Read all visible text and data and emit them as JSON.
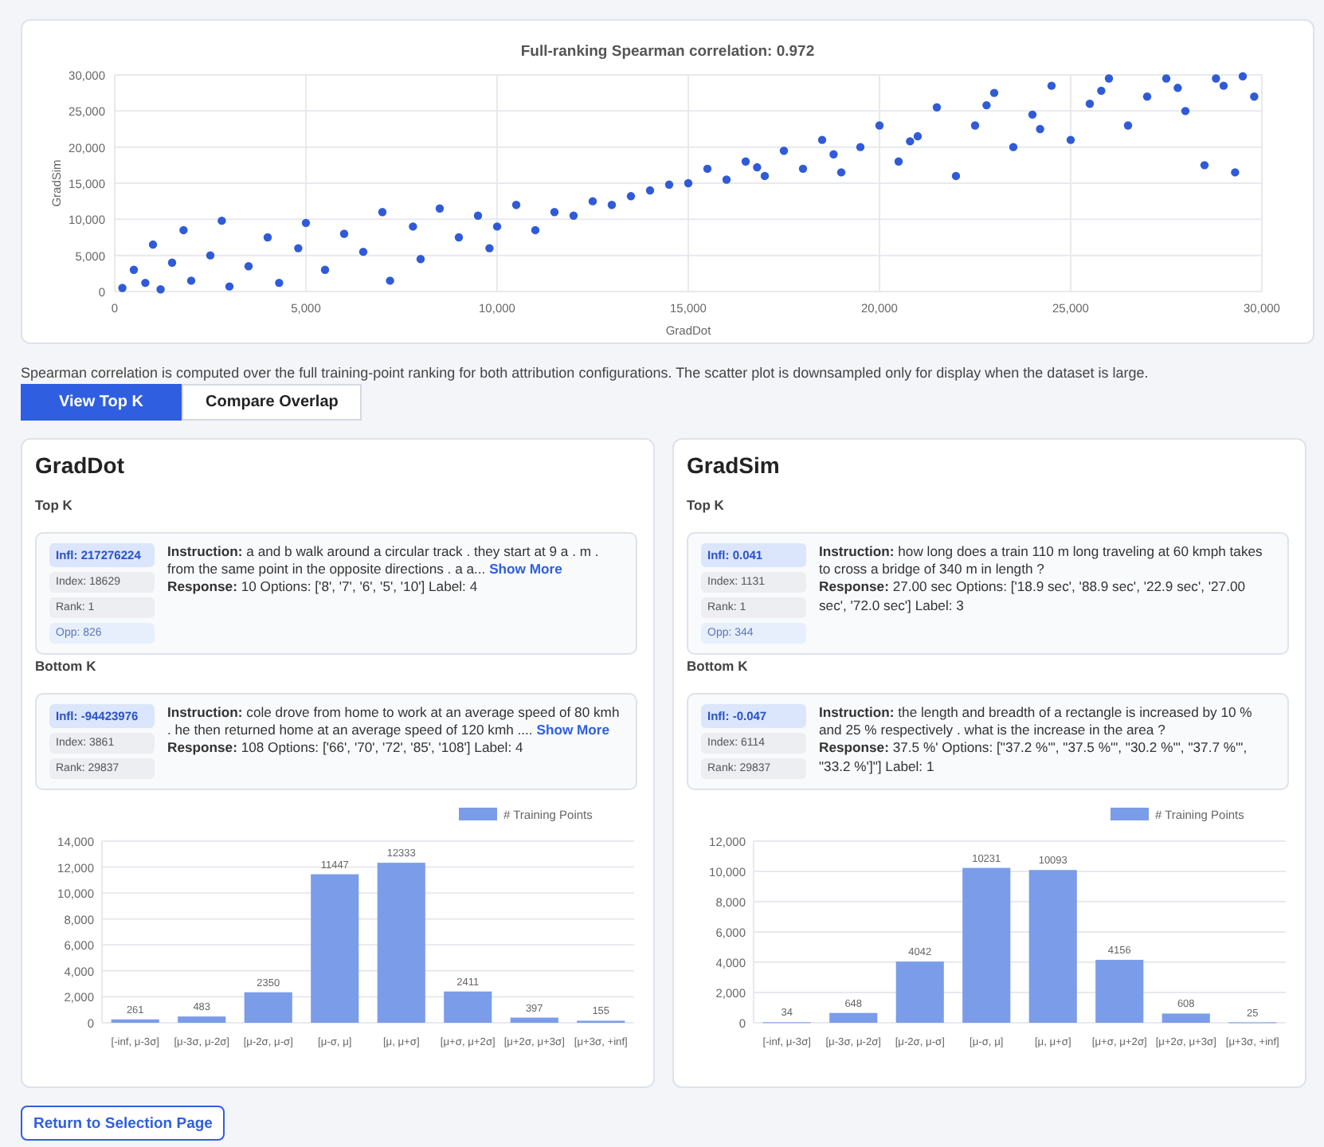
{
  "scatter": {
    "chart_data": {
      "type": "scatter",
      "title": "Full-ranking Spearman correlation: 0.972",
      "xlabel": "GradDot",
      "ylabel": "GradSim",
      "grid": true,
      "xlim": [
        0,
        30000
      ],
      "ylim": [
        0,
        30000
      ],
      "xticks": [
        {
          "value": 0,
          "label": "0"
        },
        {
          "value": 5000,
          "label": "5,000"
        },
        {
          "value": 10000,
          "label": "10,000"
        },
        {
          "value": 15000,
          "label": "15,000"
        },
        {
          "value": 20000,
          "label": "20,000"
        },
        {
          "value": 25000,
          "label": "25,000"
        },
        {
          "value": 30000,
          "label": "30,000"
        }
      ],
      "yticks": [
        {
          "value": 0,
          "label": "0"
        },
        {
          "value": 5000,
          "label": "5,000"
        },
        {
          "value": 10000,
          "label": "10,000"
        },
        {
          "value": 15000,
          "label": "15,000"
        },
        {
          "value": 20000,
          "label": "20,000"
        },
        {
          "value": 25000,
          "label": "25,000"
        },
        {
          "value": 30000,
          "label": "30,000"
        }
      ],
      "x": [
        200,
        500,
        800,
        1000,
        1200,
        1500,
        1800,
        2000,
        2500,
        2800,
        3000,
        3500,
        4000,
        4300,
        4800,
        5000,
        5500,
        6000,
        6500,
        7000,
        7200,
        7800,
        8000,
        8500,
        9000,
        9500,
        9800,
        10000,
        10500,
        11000,
        11500,
        12000,
        12500,
        13000,
        13500,
        14000,
        14500,
        15000,
        15500,
        16000,
        16500,
        16800,
        17000,
        17500,
        18000,
        18500,
        18800,
        19000,
        19500,
        20000,
        20500,
        20800,
        21000,
        21500,
        22000,
        22500,
        22800,
        23000,
        23500,
        24000,
        24200,
        24500,
        25000,
        25500,
        25800,
        26000,
        26500,
        27000,
        27500,
        27800,
        28000,
        28500,
        28800,
        29000,
        29300,
        29500,
        29800
      ],
      "series": [
        {
          "color": "#2f5bd8",
          "values": [
            500,
            3000,
            1200,
            6500,
            300,
            4000,
            8500,
            1500,
            5000,
            9800,
            700,
            3500,
            7500,
            1200,
            6000,
            9500,
            3000,
            8000,
            5500,
            11000,
            1500,
            9000,
            4500,
            11500,
            7500,
            10500,
            6000,
            9000,
            12000,
            8500,
            11000,
            10500,
            12500,
            12000,
            13200,
            14000,
            14800,
            15000,
            17000,
            15500,
            18000,
            17200,
            16000,
            19500,
            17000,
            21000,
            19000,
            16500,
            20000,
            23000,
            18000,
            20800,
            21500,
            25500,
            16000,
            23000,
            25800,
            27500,
            20000,
            24500,
            22500,
            28500,
            21000,
            26000,
            27800,
            29500,
            23000,
            27000,
            29500,
            28200,
            25000,
            17500,
            29500,
            28500,
            16500,
            29800,
            27000
          ]
        }
      ]
    }
  },
  "note": "Spearman correlation is computed over the full training-point ranking for both attribution configurations. The scatter plot is downsampled only for display when the dataset is large.",
  "tabs": [
    {
      "label": "View Top K",
      "selected": true
    },
    {
      "label": "Compare Overlap",
      "selected": false
    }
  ],
  "panels": [
    {
      "title": "GradDot",
      "sections": [
        {
          "heading": "Top K",
          "items": [
            {
              "badges": [
                {
                  "kind": "infl",
                  "text": "Infl: 217276224"
                },
                {
                  "kind": "plain",
                  "text": "Index: 18629"
                },
                {
                  "kind": "plain",
                  "text": "Rank: 1"
                },
                {
                  "kind": "opp",
                  "text": "Opp: 826"
                }
              ],
              "instruction": "**Instruction:** a and b walk around a circular track . they start at 9 a . m . from the same point in the opposite directions . a a...",
              "show_more": "Show More",
              "response": "**Response:** 10 Options: ['8', '7', '6', '5', '10'] Label: 4"
            }
          ]
        },
        {
          "heading": "Bottom K",
          "items": [
            {
              "badges": [
                {
                  "kind": "infl",
                  "text": "Infl: -94423976"
                },
                {
                  "kind": "plain",
                  "text": "Index: 3861"
                },
                {
                  "kind": "plain",
                  "text": "Rank: 29837"
                }
              ],
              "instruction": "**Instruction:** cole drove from home to work at an average speed of 80 kmh . he then returned home at an average speed of 120 kmh ....",
              "show_more": "Show More",
              "response": "**Response:** 108 Options: ['66', '70', '72', '85', '108'] Label: 4"
            }
          ]
        }
      ],
      "chart_data": {
        "type": "bar",
        "grid": true,
        "categories": [
          "[-inf, μ-3σ]",
          "[μ-3σ, μ-2σ]",
          "[μ-2σ, μ-σ]",
          "[μ-σ, μ]",
          "[μ, μ+σ]",
          "[μ+σ, μ+2σ]",
          "[μ+2σ, μ+3σ]",
          "[μ+3σ, +inf]"
        ],
        "ylim": [
          0,
          14000
        ],
        "yticks": [
          {
            "value": 0,
            "label": "0"
          },
          {
            "value": 2000,
            "label": "2,000"
          },
          {
            "value": 4000,
            "label": "4,000"
          },
          {
            "value": 6000,
            "label": "6,000"
          },
          {
            "value": 8000,
            "label": "8,000"
          },
          {
            "value": 10000,
            "label": "10,000"
          },
          {
            "value": 12000,
            "label": "12,000"
          },
          {
            "value": 14000,
            "label": "14,000"
          }
        ],
        "data_labels": true,
        "series": [
          {
            "name": "# Training Points",
            "color": "#7b9ce9",
            "values": [
              261,
              483,
              2350,
              11447,
              12333,
              2411,
              397,
              155
            ]
          }
        ]
      }
    },
    {
      "title": "GradSim",
      "sections": [
        {
          "heading": "Top K",
          "items": [
            {
              "badges": [
                {
                  "kind": "infl",
                  "text": "Infl: 0.041"
                },
                {
                  "kind": "plain",
                  "text": "Index: 1131"
                },
                {
                  "kind": "plain",
                  "text": "Rank: 1"
                },
                {
                  "kind": "opp",
                  "text": "Opp: 344"
                }
              ],
              "instruction": "**Instruction:** how long does a train 110 m long traveling at 60 kmph takes to cross a bridge of 340 m in length ?",
              "response": "**Response:** 27.00 sec Options: ['18.9 sec', '88.9 sec', '22.9 sec', '27.00 sec', '72.0 sec'] Label: 3"
            }
          ]
        },
        {
          "heading": "Bottom K",
          "items": [
            {
              "badges": [
                {
                  "kind": "infl",
                  "text": "Infl: -0.047"
                },
                {
                  "kind": "plain",
                  "text": "Index: 6114"
                },
                {
                  "kind": "plain",
                  "text": "Rank: 29837"
                }
              ],
              "instruction": "**Instruction:** the length and breadth of a rectangle is increased by 10 % and 25 % respectively . what is the increase in the area ?",
              "response": "**Response:** 37.5 %' Options: [\"37.2 %'\", \"37.5 %'\", \"30.2 %'\", \"37.7 %'\", \"33.2 %']\"] Label: 1"
            }
          ]
        }
      ],
      "chart_data": {
        "type": "bar",
        "grid": true,
        "categories": [
          "[-inf, μ-3σ]",
          "[μ-3σ, μ-2σ]",
          "[μ-2σ, μ-σ]",
          "[μ-σ, μ]",
          "[μ, μ+σ]",
          "[μ+σ, μ+2σ]",
          "[μ+2σ, μ+3σ]",
          "[μ+3σ, +inf]"
        ],
        "ylim": [
          0,
          12000
        ],
        "yticks": [
          {
            "value": 0,
            "label": "0"
          },
          {
            "value": 2000,
            "label": "2,000"
          },
          {
            "value": 4000,
            "label": "4,000"
          },
          {
            "value": 6000,
            "label": "6,000"
          },
          {
            "value": 8000,
            "label": "8,000"
          },
          {
            "value": 10000,
            "label": "10,000"
          },
          {
            "value": 12000,
            "label": "12,000"
          }
        ],
        "data_labels": true,
        "series": [
          {
            "name": "# Training Points",
            "color": "#7b9ce9",
            "values": [
              34,
              648,
              4042,
              10231,
              10093,
              4156,
              608,
              25
            ]
          }
        ]
      }
    }
  ],
  "return_button": "Return to Selection Page"
}
